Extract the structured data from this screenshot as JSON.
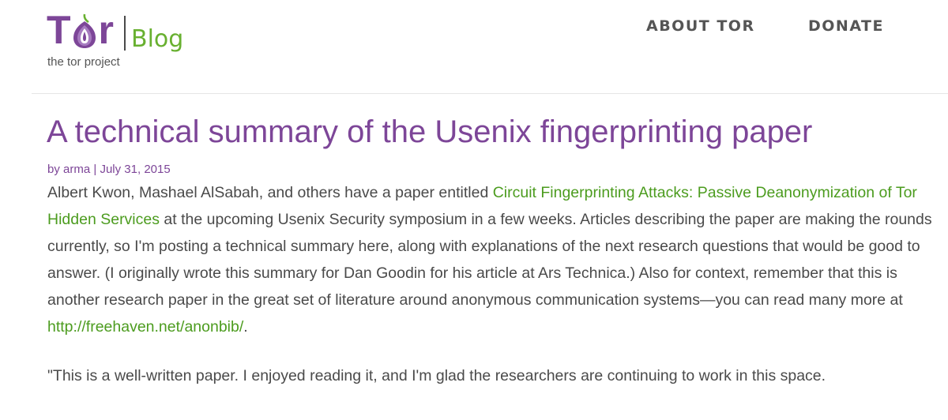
{
  "header": {
    "logo": {
      "wordmark_left": "T",
      "wordmark_right": "r",
      "section": "Blog",
      "tagline": "the tor project"
    },
    "nav": [
      {
        "label": "ABOUT TOR"
      },
      {
        "label": "DONATE"
      }
    ]
  },
  "post": {
    "title": "A technical summary of the Usenix fingerprinting paper",
    "meta": {
      "by": "by",
      "author": "arma",
      "separator": "|",
      "date": "July 31, 2015"
    },
    "paragraph1": {
      "t1": "Albert Kwon, Mashael AlSabah, and others have a paper entitled ",
      "link1": "Circuit Fingerprinting Attacks: Passive Deanonymization of Tor Hidden Services",
      "t2": " at the upcoming Usenix Security symposium in a few weeks. Articles describing the paper are making the rounds currently, so I'm posting a technical summary here, along with explanations of the next research questions that would be good to answer. (I originally wrote this summary for Dan Goodin for his article at Ars Technica.) Also for context, remember that this is another research paper in the great set of literature around anonymous communication systems—you can read many more at ",
      "link2": "http://freehaven.net/anonbib/",
      "t3": "."
    },
    "paragraph2": "\"This is a well-written paper. I enjoyed reading it, and I'm glad the researchers are continuing to work in this space."
  },
  "colors": {
    "brand_purple": "#7d4698",
    "brand_green": "#68b030",
    "link_green": "#4c9c1f",
    "text": "#4a4a4a"
  }
}
